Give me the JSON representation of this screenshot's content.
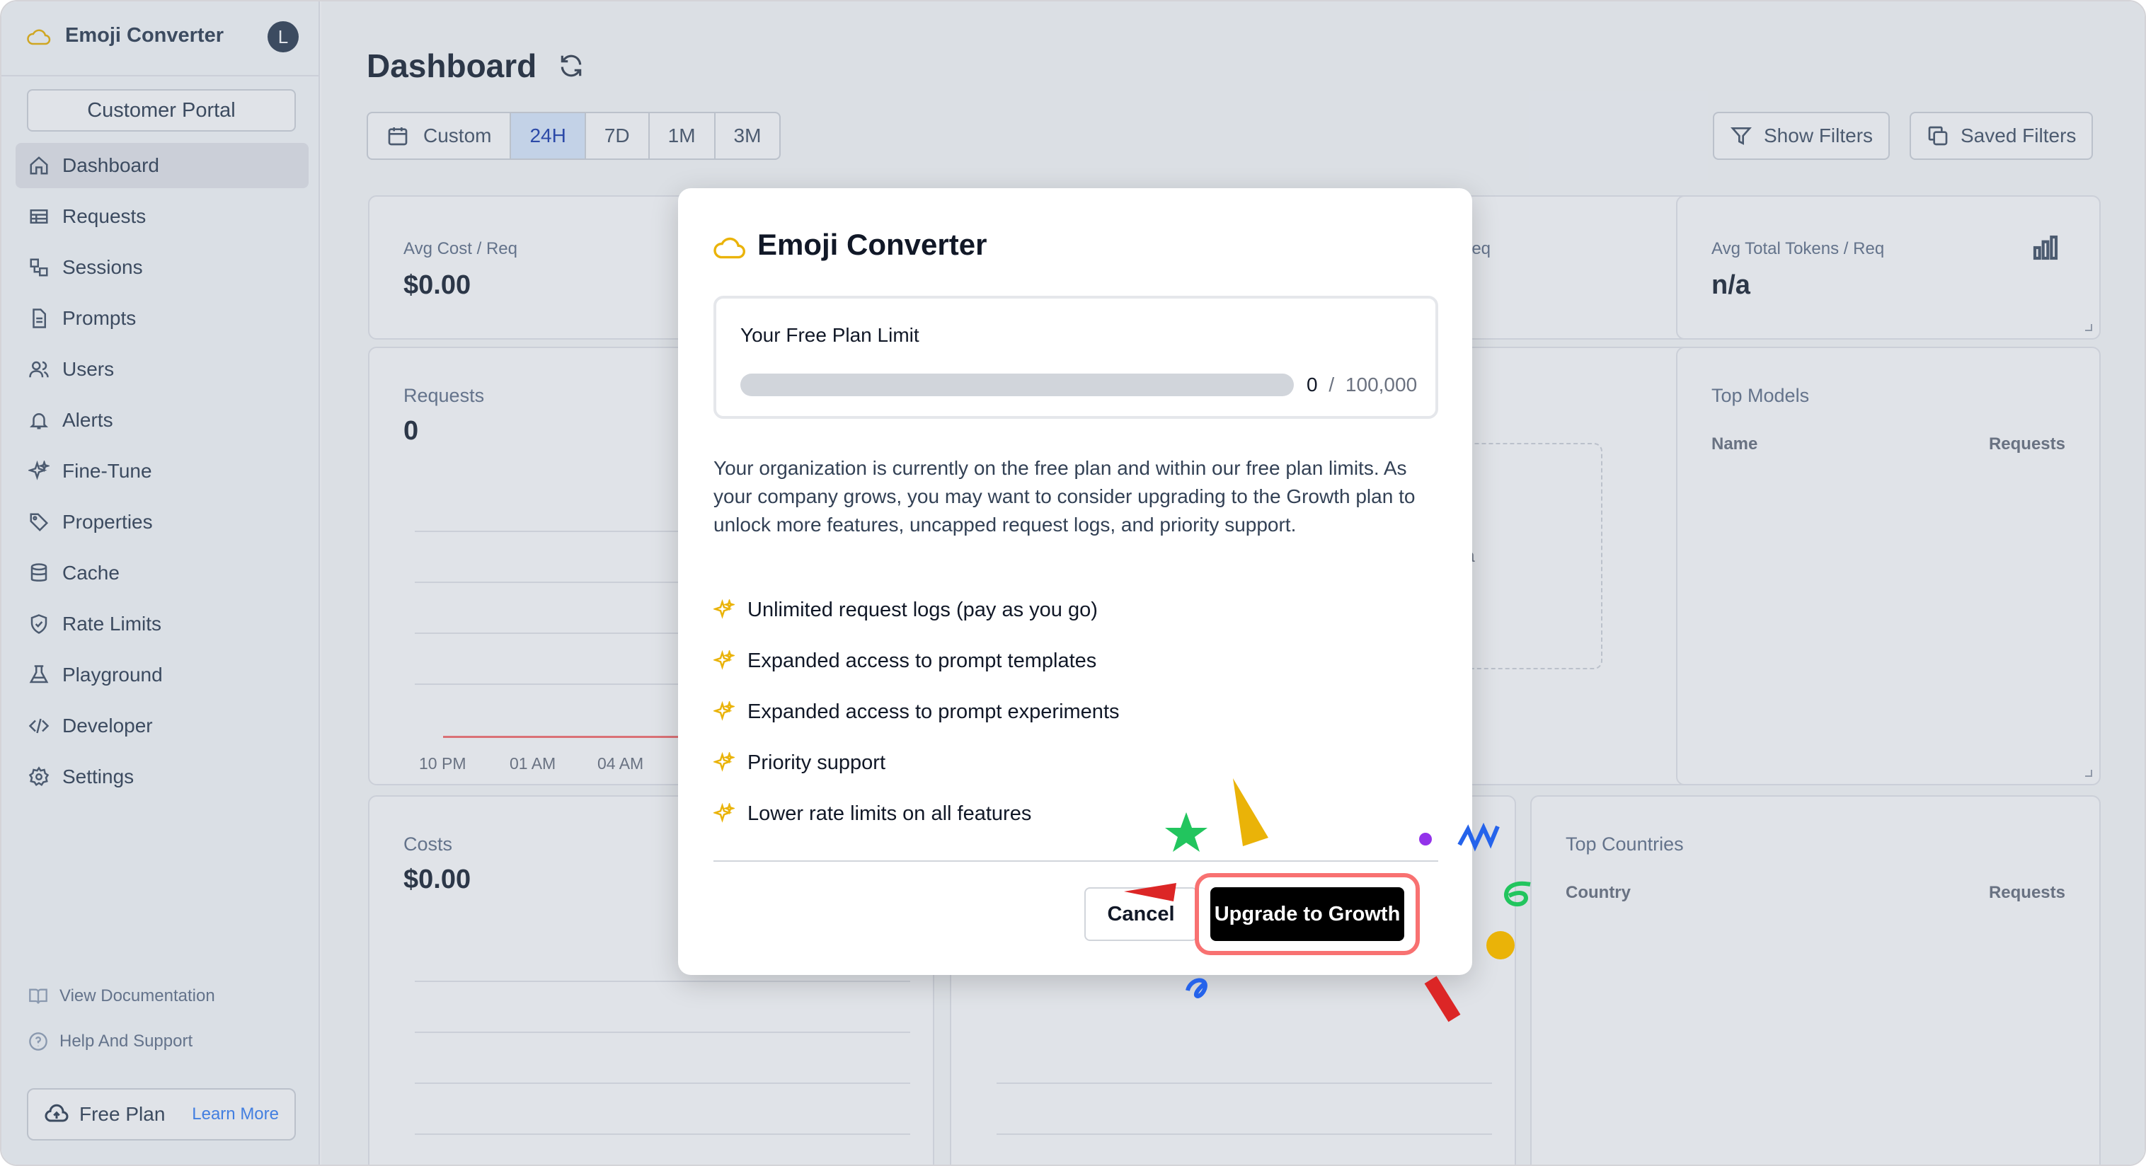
{
  "colors": {
    "accent": "#3b82f6",
    "brand_logo": "#eab308",
    "highlight_ring": "#f87171",
    "primary_button": "#000000"
  },
  "sidebar": {
    "app_name": "Emoji Converter",
    "avatar_initial": "L",
    "customer_portal": "Customer Portal",
    "items": [
      {
        "label": "Dashboard",
        "icon": "home-icon",
        "active": true
      },
      {
        "label": "Requests",
        "icon": "table-icon"
      },
      {
        "label": "Sessions",
        "icon": "sessions-icon"
      },
      {
        "label": "Prompts",
        "icon": "document-icon"
      },
      {
        "label": "Users",
        "icon": "users-icon"
      },
      {
        "label": "Alerts",
        "icon": "bell-icon"
      },
      {
        "label": "Fine-Tune",
        "icon": "sparkles-icon"
      },
      {
        "label": "Properties",
        "icon": "tag-icon"
      },
      {
        "label": "Cache",
        "icon": "database-icon"
      },
      {
        "label": "Rate Limits",
        "icon": "shield-icon"
      },
      {
        "label": "Playground",
        "icon": "beaker-icon"
      },
      {
        "label": "Developer",
        "icon": "code-icon"
      },
      {
        "label": "Settings",
        "icon": "gear-icon"
      }
    ],
    "footer": {
      "docs": "View Documentation",
      "help": "Help And Support",
      "plan": "Free Plan",
      "learn_more": "Learn More"
    }
  },
  "main": {
    "title": "Dashboard",
    "ranges": {
      "custom": "Custom",
      "r24h": "24H",
      "r7d": "7D",
      "r1m": "1M",
      "r3m": "3M",
      "selected": "24H"
    },
    "show_filters": "Show Filters",
    "saved_filters": "Saved Filters",
    "cards": {
      "avg_cost_label": "Avg Cost / Req",
      "avg_cost_value": "$0.00",
      "partial_req_label": "Req",
      "avg_tokens_label": "Avg Total Tokens / Req",
      "avg_tokens_value": "n/a",
      "requests_label": "Requests",
      "requests_value": "0",
      "requests_ticks": [
        "10 PM",
        "01 AM",
        "04 AM"
      ],
      "partial_text": "ta",
      "top_models_label": "Top Models",
      "top_models_col1": "Name",
      "top_models_col2": "Requests",
      "costs_label": "Costs",
      "costs_value": "$0.00",
      "top_countries_label": "Top Countries",
      "top_countries_col1": "Country",
      "top_countries_col2": "Requests"
    }
  },
  "modal": {
    "title": "Emoji Converter",
    "limit_title": "Your Free Plan Limit",
    "limit_used": "0",
    "limit_separator": "/",
    "limit_max": "100,000",
    "limit_fraction": 0,
    "description": "Your organization is currently on the free plan and within our free plan limits. As your company grows, you may want to consider upgrading to the Growth plan to unlock more features, uncapped request logs, and priority support.",
    "features": [
      "Unlimited request logs (pay as you go)",
      "Expanded access to prompt templates",
      "Expanded access to prompt experiments",
      "Priority support",
      "Lower rate limits on all features"
    ],
    "cancel": "Cancel",
    "upgrade": "Upgrade to Growth"
  }
}
